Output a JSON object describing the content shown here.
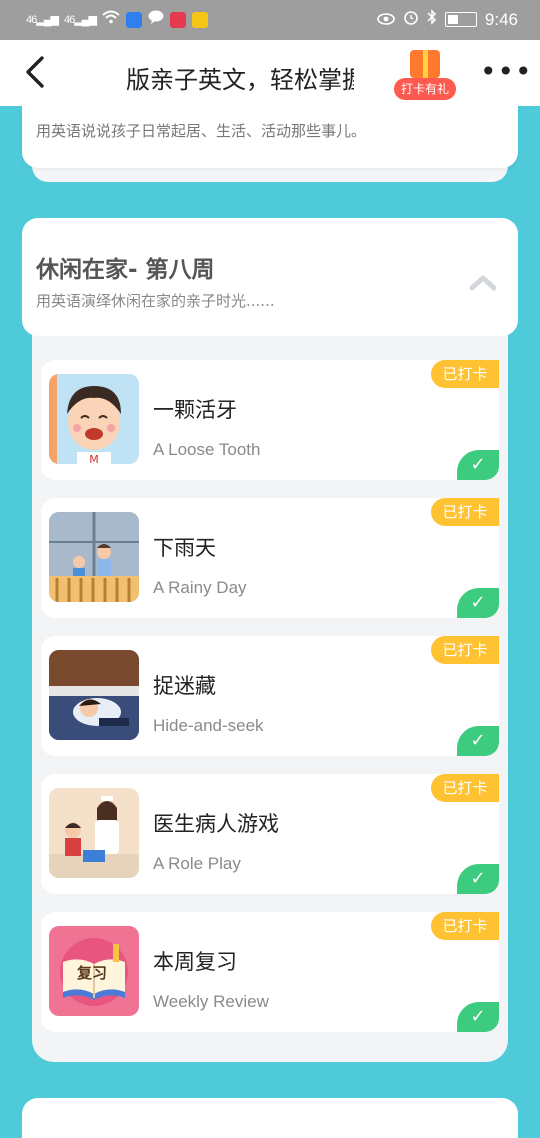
{
  "status_bar": {
    "signal1": "46",
    "signal2": "46",
    "time": "9:46"
  },
  "header": {
    "back_glyph": "‹",
    "title": "版亲子英文，轻松掌握",
    "gift_label": "打卡有礼",
    "more_glyph": "•••"
  },
  "top_card": {
    "description": "用英语说说孩子日常起居、生活、活动那些事儿。"
  },
  "week_section": {
    "title": "休闲在家- 第八周",
    "description": "用英语演绎休闲在家的亲子时光......"
  },
  "lessons": [
    {
      "title": "一颗活牙",
      "subtitle": "A Loose Tooth",
      "badge": "已打卡",
      "icon": "tooth-boy-thumbnail"
    },
    {
      "title": "下雨天",
      "subtitle": "A Rainy Day",
      "badge": "已打卡",
      "icon": "rainy-window-thumbnail"
    },
    {
      "title": "捉迷藏",
      "subtitle": "Hide-and-seek",
      "badge": "已打卡",
      "icon": "hide-seek-thumbnail"
    },
    {
      "title": "医生病人游戏",
      "subtitle": "A Role Play",
      "badge": "已打卡",
      "icon": "doctor-play-thumbnail"
    },
    {
      "title": "本周复习",
      "subtitle": "Weekly Review",
      "badge": "已打卡",
      "icon": "review-book-thumbnail",
      "thumb_text": "复习"
    }
  ],
  "colors": {
    "background": "#4ECAD8",
    "badge": "#FFC233",
    "check": "#3CCB7F",
    "gift": "#FF5A4F"
  }
}
